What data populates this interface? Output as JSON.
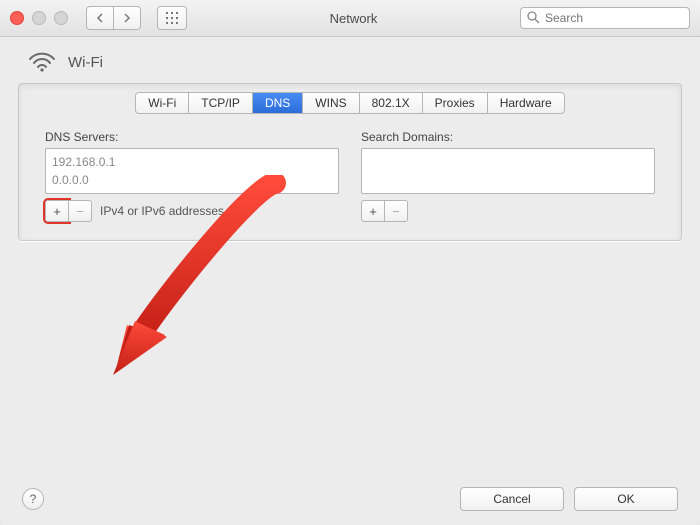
{
  "titlebar": {
    "window_title": "Network",
    "search_placeholder": "Search"
  },
  "header": {
    "connection_name": "Wi-Fi"
  },
  "tabs": [
    {
      "label": "Wi-Fi",
      "active": false
    },
    {
      "label": "TCP/IP",
      "active": false
    },
    {
      "label": "DNS",
      "active": true
    },
    {
      "label": "WINS",
      "active": false
    },
    {
      "label": "802.1X",
      "active": false
    },
    {
      "label": "Proxies",
      "active": false
    },
    {
      "label": "Hardware",
      "active": false
    }
  ],
  "dns": {
    "label": "DNS Servers:",
    "entries": [
      "192.168.0.1",
      "0.0.0.0"
    ],
    "hint": "IPv4 or IPv6 addresses",
    "plus": "+",
    "minus": "−"
  },
  "search_domains": {
    "label": "Search Domains:",
    "entries": [],
    "plus": "+",
    "minus": "−"
  },
  "footer": {
    "help": "?",
    "cancel": "Cancel",
    "ok": "OK"
  },
  "colors": {
    "accent": "#2b6ed9",
    "highlight": "#e1352b"
  }
}
